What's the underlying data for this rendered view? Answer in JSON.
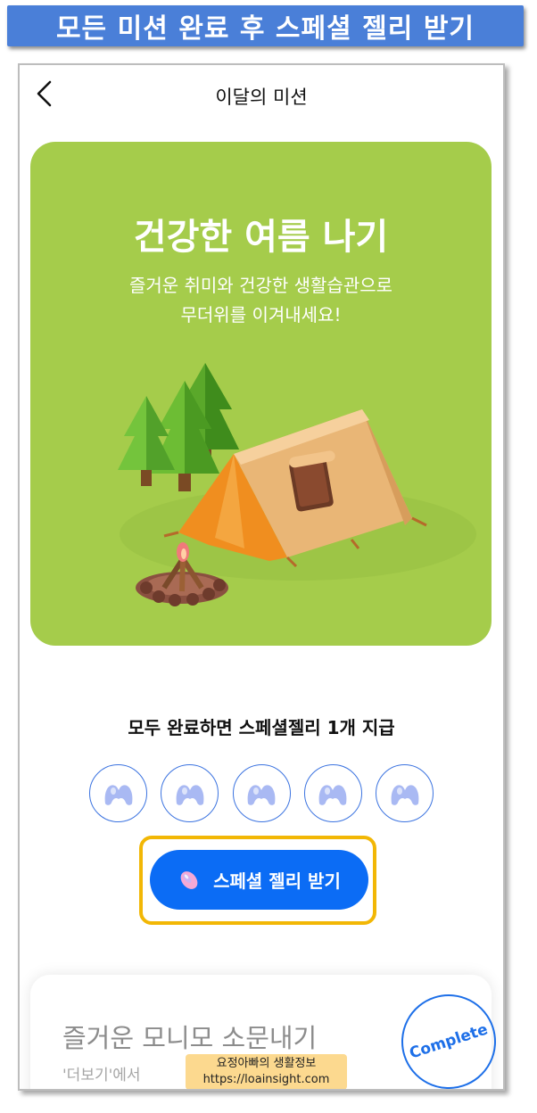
{
  "banner": {
    "text": "모든 미션 완료 후 스페셜 젤리 받기"
  },
  "header": {
    "title": "이달의 미션",
    "back_icon": "chevron-left-icon"
  },
  "hero": {
    "title": "건강한 여름 나기",
    "subtitle_line1": "즐거운 취미와 건강한 생활습관으로",
    "subtitle_line2": "무더위를 이겨내세요!",
    "background": "#a5cc4b"
  },
  "reward": {
    "notice": "모두 완료하면 스페셜젤리 1개 지급",
    "jelly_slots": 5,
    "claim_button_label": "스페셜 젤리 받기",
    "button_color": "#0b6cf5",
    "highlight_color": "#f2b705"
  },
  "mission": {
    "title": "즐거운 모니모 소문내기",
    "description": "'더보기'에서",
    "stamp_label": "Complete"
  },
  "watermark": {
    "line1": "요정아빠의 생활정보",
    "line2": "https://loainsight.com"
  },
  "colors": {
    "banner": "#4a7fd8",
    "accent_blue": "#1d6fe8"
  }
}
